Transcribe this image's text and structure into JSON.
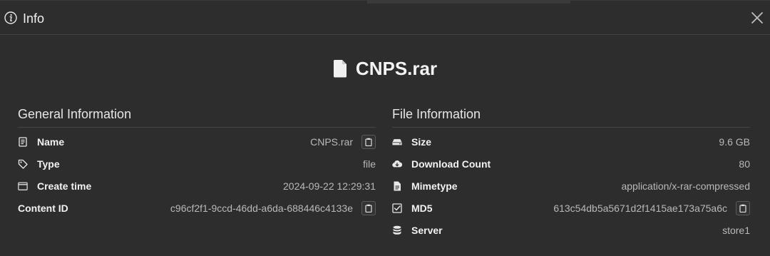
{
  "header": {
    "title": "Info",
    "icons": {
      "info": "info-circle-icon",
      "close": "close-icon"
    }
  },
  "file": {
    "name": "CNPS.rar",
    "icon": "file-icon"
  },
  "general": {
    "title": "General Information",
    "rows": [
      {
        "label": "Name",
        "value": "CNPS.rar",
        "icon": "document-icon",
        "copy": true
      },
      {
        "label": "Type",
        "value": "file",
        "icon": "tag-icon",
        "copy": false
      },
      {
        "label": "Create time",
        "value": "2024-09-22 12:29:31",
        "icon": "calendar-icon",
        "copy": false
      },
      {
        "label": "Content ID",
        "value": "c96cf2f1-9ccd-46dd-a6da-688446c4133e",
        "icon": "",
        "copy": true
      }
    ]
  },
  "fileinfo": {
    "title": "File Information",
    "rows": [
      {
        "label": "Size",
        "value": "9.6 GB",
        "icon": "hard-drive-icon",
        "copy": false
      },
      {
        "label": "Download Count",
        "value": "80",
        "icon": "cloud-download-icon",
        "copy": false
      },
      {
        "label": "Mimetype",
        "value": "application/x-rar-compressed",
        "icon": "file-text-icon",
        "copy": false
      },
      {
        "label": "MD5",
        "value": "613c54db5a5671d2f1415ae173a75a6c",
        "icon": "checkbox-icon",
        "copy": true
      },
      {
        "label": "Server",
        "value": "store1",
        "icon": "database-icon",
        "copy": false
      }
    ]
  },
  "colors": {
    "background": "#2d2d2d",
    "text": "#e8e8e8",
    "muted": "#b9b9b9",
    "divider": "#444444"
  }
}
